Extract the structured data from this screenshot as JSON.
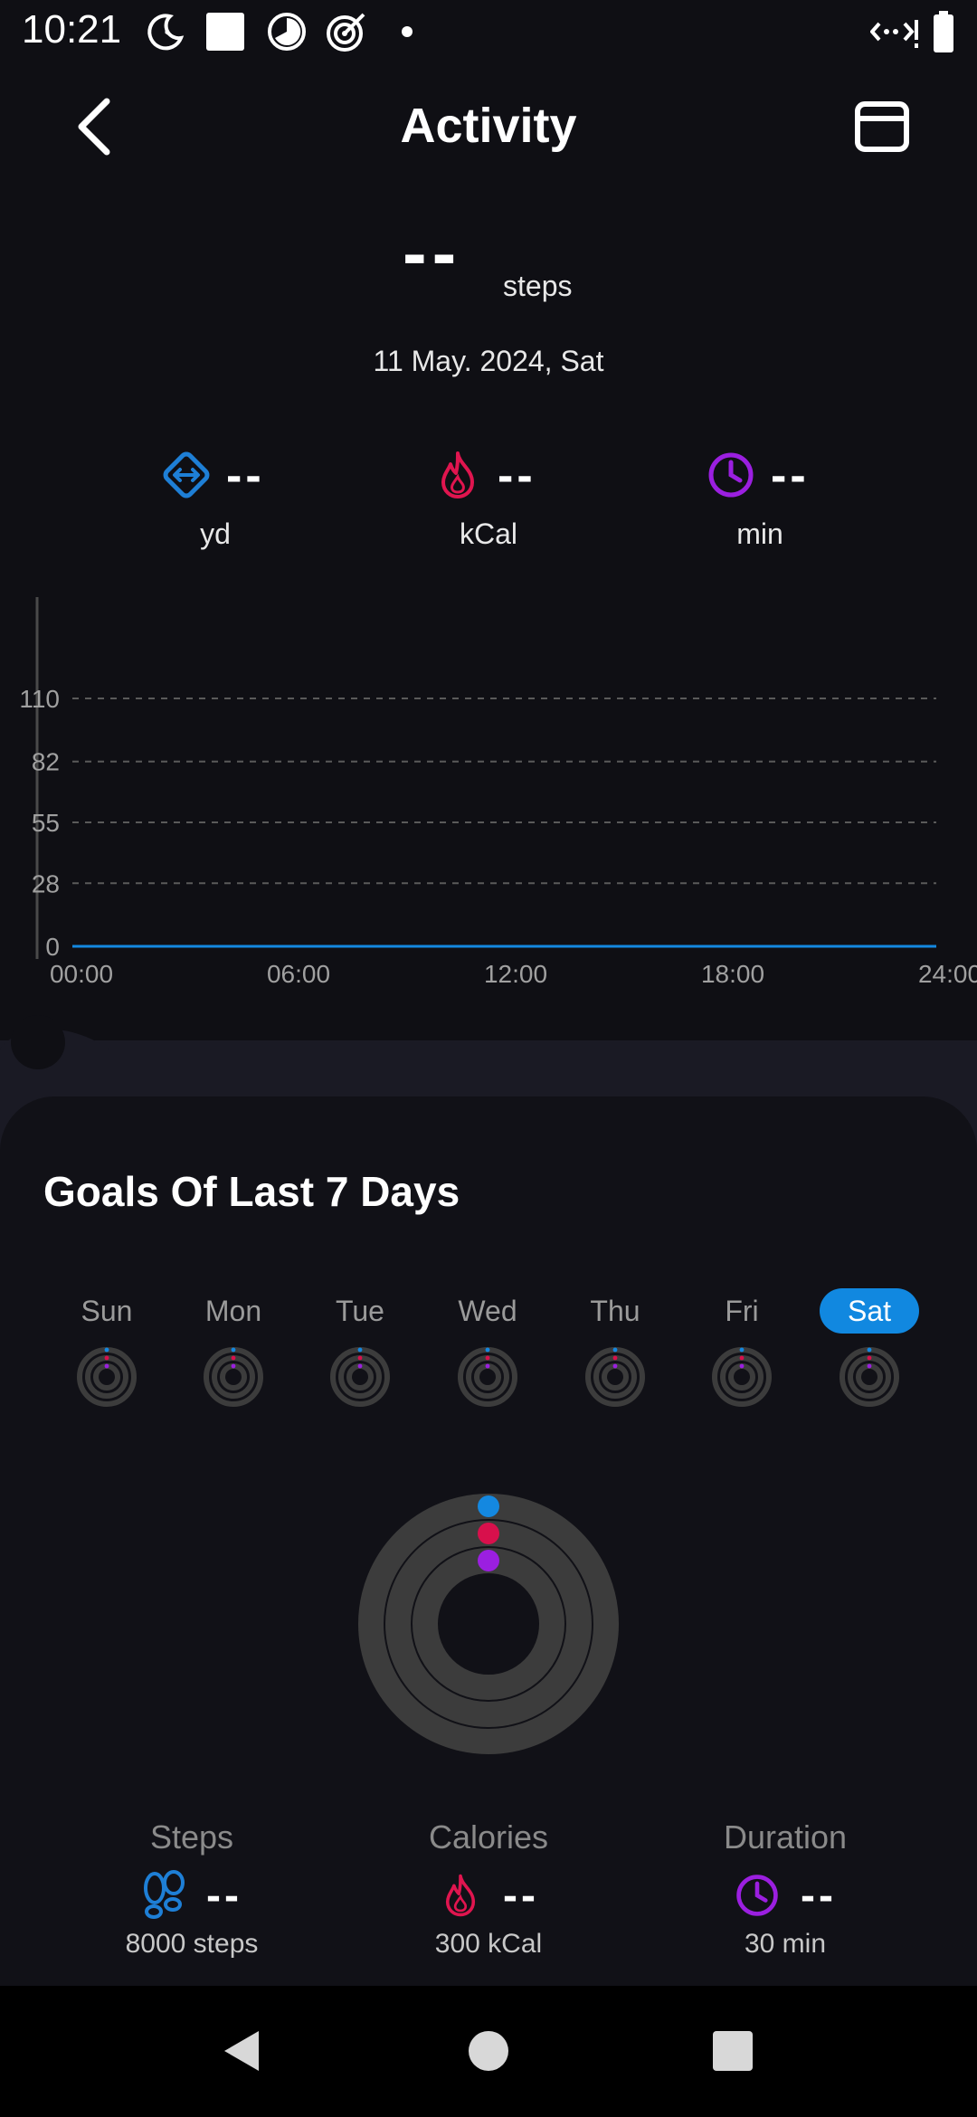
{
  "status_bar": {
    "time": "10:21",
    "icons_left": [
      "do-not-disturb-icon",
      "square-icon",
      "timer-icon",
      "target-icon",
      "dot-icon"
    ],
    "icons_right": [
      "data-transfer-icon",
      "battery-icon"
    ]
  },
  "header": {
    "title": "Activity",
    "back_icon": "chevron-left-icon",
    "calendar_icon": "calendar-icon"
  },
  "summary": {
    "steps_value": "--",
    "steps_unit": "steps",
    "date": "11 May. 2024, Sat",
    "metrics": [
      {
        "icon": "distance-icon",
        "value": "--",
        "unit": "yd",
        "color": "#1e7fd6"
      },
      {
        "icon": "flame-icon",
        "value": "--",
        "unit": "kCal",
        "color": "#e0154f"
      },
      {
        "icon": "clock-icon",
        "value": "--",
        "unit": "min",
        "color": "#9b1fe0"
      }
    ]
  },
  "chart_data": {
    "type": "line",
    "x_tick_labels": [
      "00:00",
      "06:00",
      "12:00",
      "18:00",
      "24:00"
    ],
    "y_tick_labels": [
      "0",
      "28",
      "55",
      "82",
      "110"
    ],
    "y_ticks": [
      0,
      28,
      55,
      82,
      110
    ],
    "ylim": [
      0,
      110
    ],
    "series": [
      {
        "values": [
          0,
          0,
          0,
          0,
          0
        ]
      }
    ],
    "grid": true,
    "line_color": "#1488e0"
  },
  "goals": {
    "title": "Goals Of Last 7 Days",
    "days": [
      {
        "label": "Sun",
        "selected": false
      },
      {
        "label": "Mon",
        "selected": false
      },
      {
        "label": "Tue",
        "selected": false
      },
      {
        "label": "Wed",
        "selected": false
      },
      {
        "label": "Thu",
        "selected": false
      },
      {
        "label": "Fri",
        "selected": false
      },
      {
        "label": "Sat",
        "selected": true
      }
    ],
    "colors": {
      "steps": "#1488e0",
      "calories": "#d8104c",
      "duration": "#9b1fe0",
      "ring": "#3c3c3c"
    },
    "items": [
      {
        "title": "Steps",
        "icon": "footprints-icon",
        "value": "--",
        "target": "8000 steps"
      },
      {
        "title": "Calories",
        "icon": "flame-icon",
        "value": "--",
        "target": "300 kCal"
      },
      {
        "title": "Duration",
        "icon": "clock-icon",
        "value": "--",
        "target": "30 min"
      }
    ]
  },
  "nav_bar": {
    "buttons": [
      "back-nav-icon",
      "home-nav-icon",
      "recents-nav-icon"
    ]
  }
}
